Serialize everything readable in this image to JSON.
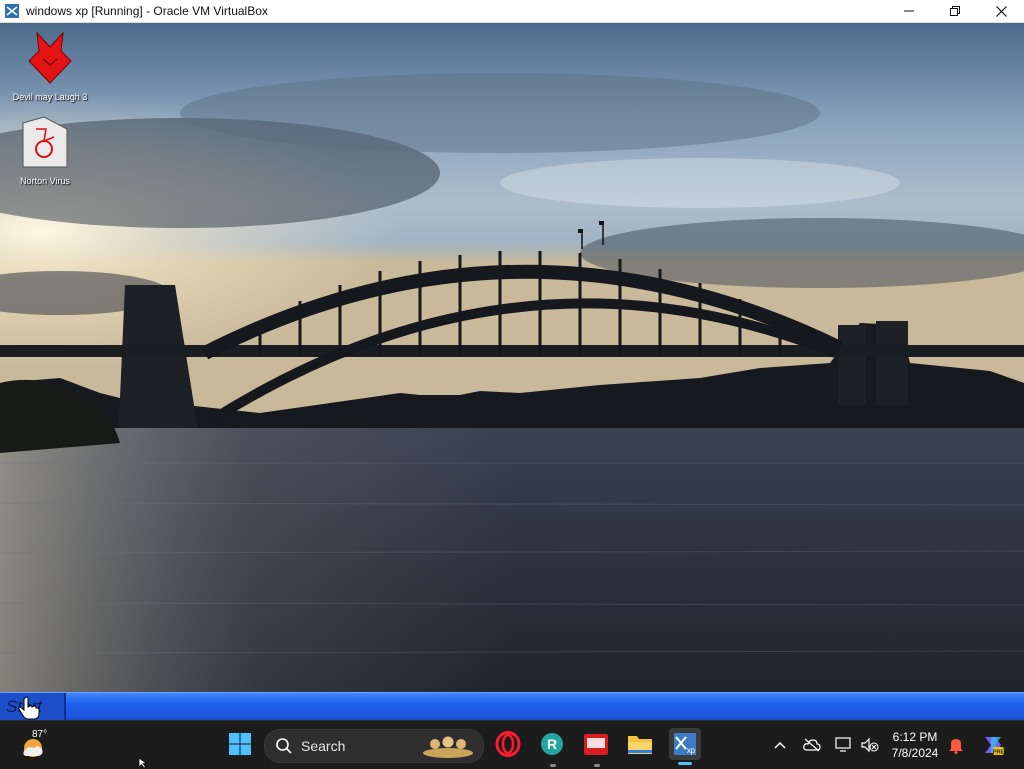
{
  "window": {
    "title": "windows xp [Running] - Oracle VM VirtualBox",
    "minimize_icon": "minimize-icon",
    "maximize_icon": "restore-icon",
    "close_icon": "close-icon"
  },
  "desktop": {
    "wallpaper": "sydney-harbour-bridge-at-sunset",
    "icons": [
      {
        "label": "Devil may Laugh 3",
        "icon": "red-devil-icon"
      },
      {
        "label": "Norton Virus",
        "icon": "norton-virus-icon"
      }
    ]
  },
  "xp_taskbar": {
    "start_label": "Start"
  },
  "host_taskbar": {
    "weather": {
      "temp": "87°",
      "icon": "weather-sun-icon"
    },
    "search_placeholder": "Search",
    "apps": [
      {
        "name": "windows-start",
        "icon": "windows-logo-icon"
      },
      {
        "name": "opera",
        "icon": "opera-icon"
      },
      {
        "name": "app-r",
        "icon": "r-app-icon"
      },
      {
        "name": "app-red",
        "icon": "red-app-icon"
      },
      {
        "name": "file-explorer",
        "icon": "folder-icon"
      },
      {
        "name": "virtualbox-xp",
        "icon": "virtualbox-xp-icon"
      }
    ],
    "clock": {
      "time": "6:12 PM",
      "date": "7/8/2024"
    }
  },
  "colors": {
    "xp_taskbar": "#1f5fea",
    "host_taskbar": "#1c1c1c",
    "accent": "#4cc2ff"
  }
}
